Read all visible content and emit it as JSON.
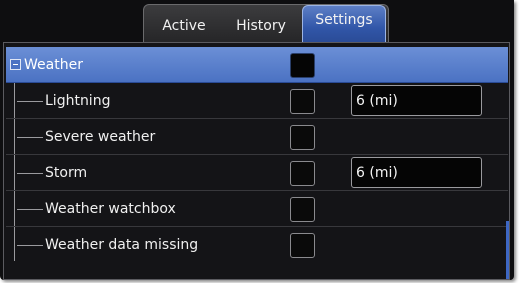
{
  "tabs": [
    {
      "label": "Active",
      "active": false
    },
    {
      "label": "History",
      "active": false
    },
    {
      "label": "Settings",
      "active": true
    }
  ],
  "group": {
    "label": "Weather",
    "expanded": true,
    "checked": false
  },
  "items": [
    {
      "label": "Lightning",
      "checked": false,
      "value": "6 (mi)"
    },
    {
      "label": "Severe weather",
      "checked": false,
      "value": ""
    },
    {
      "label": "Storm",
      "checked": false,
      "value": "6 (mi)"
    },
    {
      "label": "Weather watchbox",
      "checked": false,
      "value": ""
    },
    {
      "label": "Weather data missing",
      "checked": false,
      "value": ""
    }
  ],
  "colors": {
    "accent": "#4b72c3",
    "background": "#141417"
  }
}
